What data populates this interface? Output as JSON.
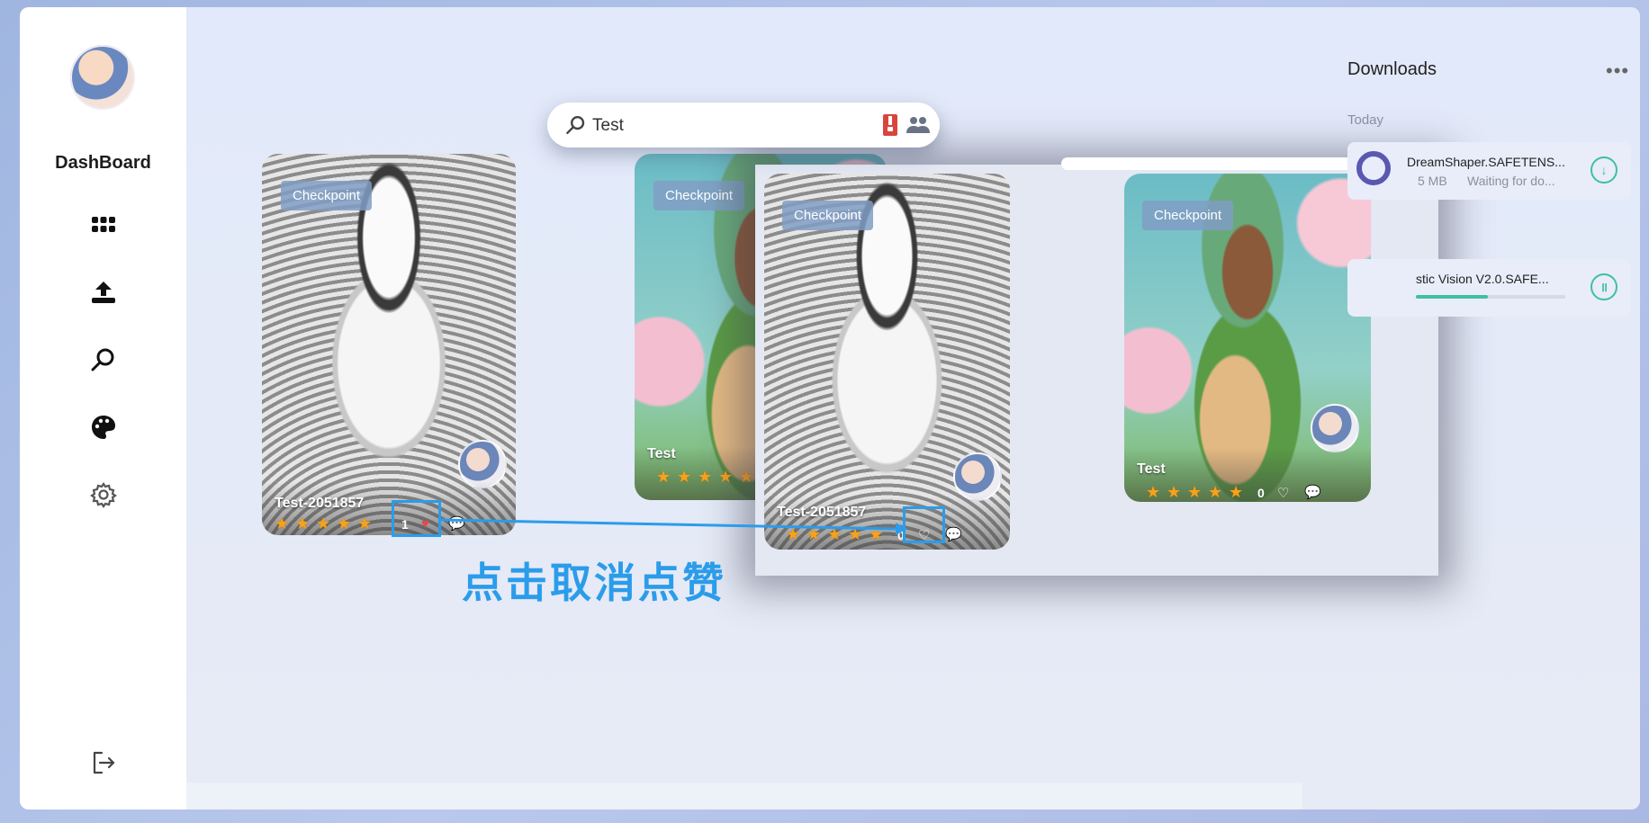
{
  "sidebar": {
    "brand": "DashBoard",
    "items": [
      {
        "name": "grid-icon"
      },
      {
        "name": "upload-icon"
      },
      {
        "name": "search-icon"
      },
      {
        "name": "palette-icon"
      },
      {
        "name": "settings-icon"
      }
    ],
    "logout_icon": "logout-icon"
  },
  "search": {
    "value": "Test",
    "placeholder": ""
  },
  "cards": [
    {
      "badge": "Checkpoint",
      "name": "Test-2051857",
      "like_count": "1",
      "rating": 5
    },
    {
      "badge": "Checkpoint",
      "name": "Test",
      "rating": 5
    },
    {
      "badge": "Checkpoint",
      "name": "Test-2051857",
      "like_count": "0",
      "rating": 5
    },
    {
      "badge": "Checkpoint",
      "name": "Test",
      "like_count": "0",
      "rating": 5
    }
  ],
  "downloads": {
    "title": "Downloads",
    "section": "Today",
    "items": [
      {
        "name": "DreamShaper.SAFETENS...",
        "size": "5 MB",
        "status": "Waiting for do...",
        "action_icon": "download-icon"
      },
      {
        "name": "stic Vision V2.0.SAFE...",
        "progress": 0.48,
        "action_icon": "pause-icon"
      }
    ]
  },
  "annotation": {
    "text": "点击取消点赞"
  },
  "colors": {
    "accent": "#3fbfa3",
    "annotation": "#2b9cea",
    "star": "#f7a21b"
  }
}
